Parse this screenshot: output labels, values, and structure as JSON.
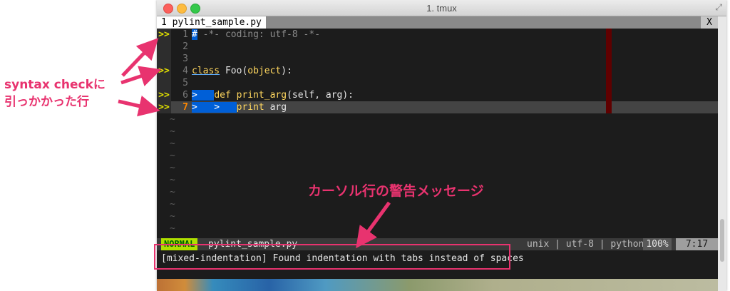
{
  "window": {
    "title": "1. tmux"
  },
  "tabline": {
    "active_tab": "1 pylint_sample.py",
    "close_label": "X"
  },
  "editor": {
    "sign_marker": ">>",
    "lines": [
      {
        "n": "1",
        "sign": true,
        "parts": [
          [
            "hl",
            "#"
          ],
          [
            "comment",
            " -*- coding: utf-8 -*-"
          ]
        ]
      },
      {
        "n": "2",
        "sign": false,
        "parts": []
      },
      {
        "n": "3",
        "sign": false,
        "parts": []
      },
      {
        "n": "4",
        "sign": true,
        "parts": [
          [
            "kwul",
            "class"
          ],
          [
            "plain",
            " Foo("
          ],
          [
            "kw",
            "object"
          ],
          [
            "plain",
            "):"
          ]
        ]
      },
      {
        "n": "5",
        "sign": false,
        "parts": []
      },
      {
        "n": "6",
        "sign": true,
        "parts": [
          [
            "hl",
            ">   "
          ],
          [
            "kw",
            "def"
          ],
          [
            "plain",
            " "
          ],
          [
            "fn",
            "print_arg"
          ],
          [
            "plain",
            "(self, arg):"
          ]
        ]
      },
      {
        "n": "7",
        "sign": true,
        "current": true,
        "parts": [
          [
            "hl",
            ">   >   "
          ],
          [
            "kw",
            "print"
          ],
          [
            "plain",
            " arg"
          ]
        ]
      }
    ],
    "tilde": "~",
    "tilde_count": 10
  },
  "statusline": {
    "mode": "NORMAL",
    "file": "pylint_sample.py",
    "info": "unix | utf-8 | python",
    "percent": "100%",
    "position": "7:17"
  },
  "message": "[mixed-indentation] Found indentation with tabs instead of spaces",
  "annotations": {
    "syntax_line1": "syntax checkに",
    "syntax_line2": "引っかかった行",
    "warning_label": "カーソル行の警告メッセージ"
  },
  "colors": {
    "accent": "#e8336f",
    "mode_bg": "#afdf00",
    "error_hl": "#005fd7"
  }
}
